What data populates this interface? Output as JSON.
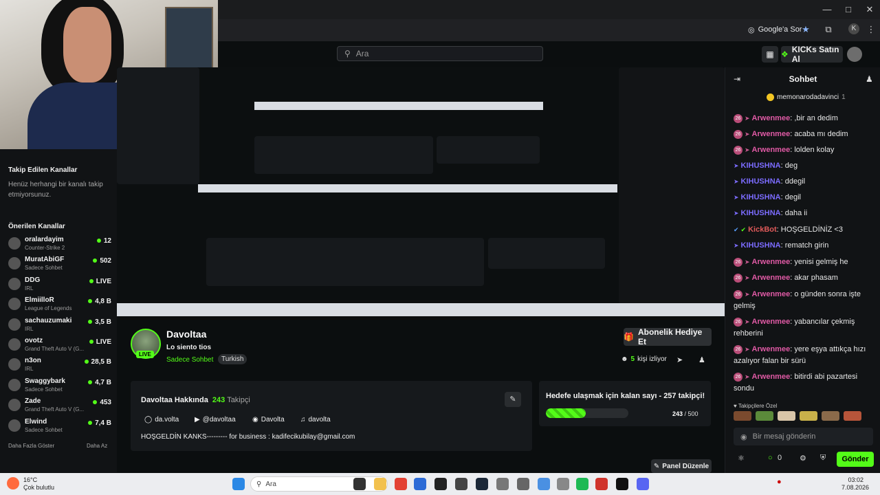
{
  "browser": {
    "ask_google_label": "Google'a Sor",
    "profile_initial": "K"
  },
  "kick": {
    "search_placeholder": "Ara",
    "buy_kicks_label": "KICKs Satın Al"
  },
  "sidebar": {
    "followed_title": "Takip Edilen Kanallar",
    "followed_empty": "Henüz herhangi bir kanalı takip etmiyorsunuz.",
    "recommended_title": "Önerilen Kanallar",
    "channels": [
      {
        "name": "oralardayim",
        "category": "Counter-Strike 2",
        "count": "12"
      },
      {
        "name": "MuratAbiGF",
        "category": "Sadece Sohbet",
        "count": "502"
      },
      {
        "name": "DDG",
        "category": "IRL",
        "count": "LIVE"
      },
      {
        "name": "ElmiilloR",
        "category": "League of Legends",
        "count": "4,8 B"
      },
      {
        "name": "sachauzumaki",
        "category": "IRL",
        "count": "3,5 B"
      },
      {
        "name": "ovotz",
        "category": "Grand Theft Auto V (G...",
        "count": "LIVE"
      },
      {
        "name": "n3on",
        "category": "IRL",
        "count": "28,5 B"
      },
      {
        "name": "Swaggybark",
        "category": "Sadece Sohbet",
        "count": "4,7 B"
      },
      {
        "name": "Zade",
        "category": "Grand Theft Auto V (G...",
        "count": "453"
      },
      {
        "name": "Elwind",
        "category": "Sadece Sohbet",
        "count": "7,4 B"
      }
    ],
    "show_more": "Daha Fazla Göster",
    "show_less": "Daha Az"
  },
  "stream": {
    "channel_name": "Davoltaa",
    "live_label": "LIVE",
    "title": "Lo siento tios",
    "category": "Sadece Sohbet",
    "language": "Turkish",
    "sub_gift_label": "Abonelik Hediye Et",
    "viewer_count": "5",
    "viewer_label": "kişi izliyor"
  },
  "about": {
    "title": "Davoltaa Hakkında",
    "followers": "243",
    "followers_label": "Takipçi",
    "socials": [
      {
        "icon": "instagram-icon",
        "label": "da.volta"
      },
      {
        "icon": "youtube-icon",
        "label": "@davoltaa"
      },
      {
        "icon": "discord-icon",
        "label": "Davolta"
      },
      {
        "icon": "tiktok-icon",
        "label": "davolta"
      }
    ],
    "bio": "HOŞGELDİN KANKS--------- for business : kadifecikubilay@gmail.com"
  },
  "goal": {
    "title": "Hedefe ulaşmak için kalan sayı - 257 takipçi!",
    "current": "243",
    "target": "500",
    "progress": 0.486
  },
  "panel_edit_label": "Panel Düzenle",
  "chat": {
    "title": "Sohbet",
    "pinned_user": "memonarodadavinci",
    "pinned_count": "1",
    "messages": [
      {
        "user": "Arwenmee",
        "type": "arw",
        "text": ",bir an dedim"
      },
      {
        "user": "Arwenmee",
        "type": "arw",
        "text": "acaba mı dedim"
      },
      {
        "user": "Arwenmee",
        "type": "arw",
        "text": "lolden kolay"
      },
      {
        "user": "KIHUSHNA",
        "type": "kih",
        "text": "deg"
      },
      {
        "user": "KIHUSHNA",
        "type": "kih",
        "text": "ddegil"
      },
      {
        "user": "KIHUSHNA",
        "type": "kih",
        "text": "degil"
      },
      {
        "user": "KIHUSHNA",
        "type": "kih",
        "text": "daha ii"
      },
      {
        "user": "KickBot",
        "type": "bot",
        "text": "HOŞGELDİNİZ <3"
      },
      {
        "user": "KIHUSHNA",
        "type": "kih",
        "text": "rematch girin"
      },
      {
        "user": "Arwenmee",
        "type": "arw",
        "text": "yenisi gelmiş he"
      },
      {
        "user": "Arwenmee",
        "type": "arw",
        "text": "akar phasam"
      },
      {
        "user": "Arwenmee",
        "type": "arw",
        "text": "o günden sonra işte gelmiş"
      },
      {
        "user": "Arwenmee",
        "type": "arw",
        "text": "yabancılar çekmiş rehberini"
      },
      {
        "user": "Arwenmee",
        "type": "arw",
        "text": "yere eşya attıkça hızı azalıyor falan bir sürü"
      },
      {
        "user": "Arwenmee",
        "type": "arw",
        "text": "bitirdi abi pazartesi sondu"
      }
    ],
    "sub_emotes_label": "Takipçilere Özel",
    "input_placeholder": "Bir mesaj gönderin",
    "points": "0",
    "send_label": "Gönder"
  },
  "taskbar": {
    "temperature": "16°C",
    "weather": "Çok bulutlu",
    "search_placeholder": "Ara",
    "time": "03:02",
    "date": "7.08.2026"
  }
}
